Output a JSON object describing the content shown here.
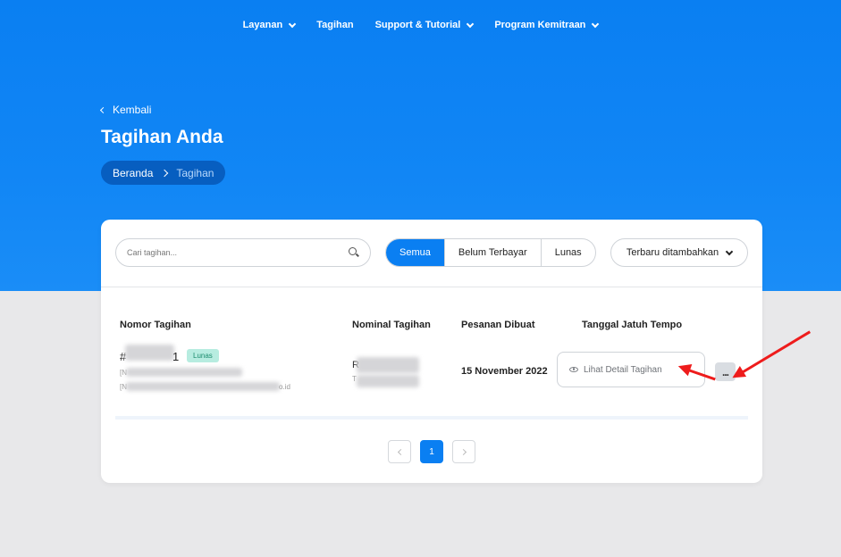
{
  "nav": {
    "items": [
      {
        "label": "Layanan",
        "dropdown": true
      },
      {
        "label": "Tagihan",
        "dropdown": false
      },
      {
        "label": "Support & Tutorial",
        "dropdown": true
      },
      {
        "label": "Program Kemitraan",
        "dropdown": true
      }
    ]
  },
  "header": {
    "back_label": "Kembali",
    "title": "Tagihan Anda",
    "breadcrumb": {
      "home": "Beranda",
      "current": "Tagihan"
    }
  },
  "toolbar": {
    "search_placeholder": "Cari tagihan...",
    "filters": [
      "Semua",
      "Belum Terbayar",
      "Lunas"
    ],
    "active_filter": "Semua",
    "sort_label": "Terbaru ditambahkan"
  },
  "table": {
    "headers": {
      "nomor": "Nomor Tagihan",
      "nominal": "Nominal Tagihan",
      "dibuat": "Pesanan Dibuat",
      "jatuh_tempo": "Tanggal Jatuh Tempo"
    },
    "rows": [
      {
        "number_prefix": "#",
        "number_suffix": "1",
        "status": "Lunas",
        "line1_prefix": "[N",
        "line2_prefix": "[N",
        "line2_suffix": "o.id",
        "nominal_prefix": "R",
        "nominal_sub_prefix": "T",
        "created": "15 November 2022",
        "detail_label": "Lihat Detail Tagihan",
        "more_label": "..."
      }
    ]
  },
  "pagination": {
    "pages": [
      "1"
    ],
    "current": "1"
  },
  "colors": {
    "primary": "#0a7ff2",
    "badge_bg": "#b7ece0",
    "annotation": "#ee1c1c"
  }
}
